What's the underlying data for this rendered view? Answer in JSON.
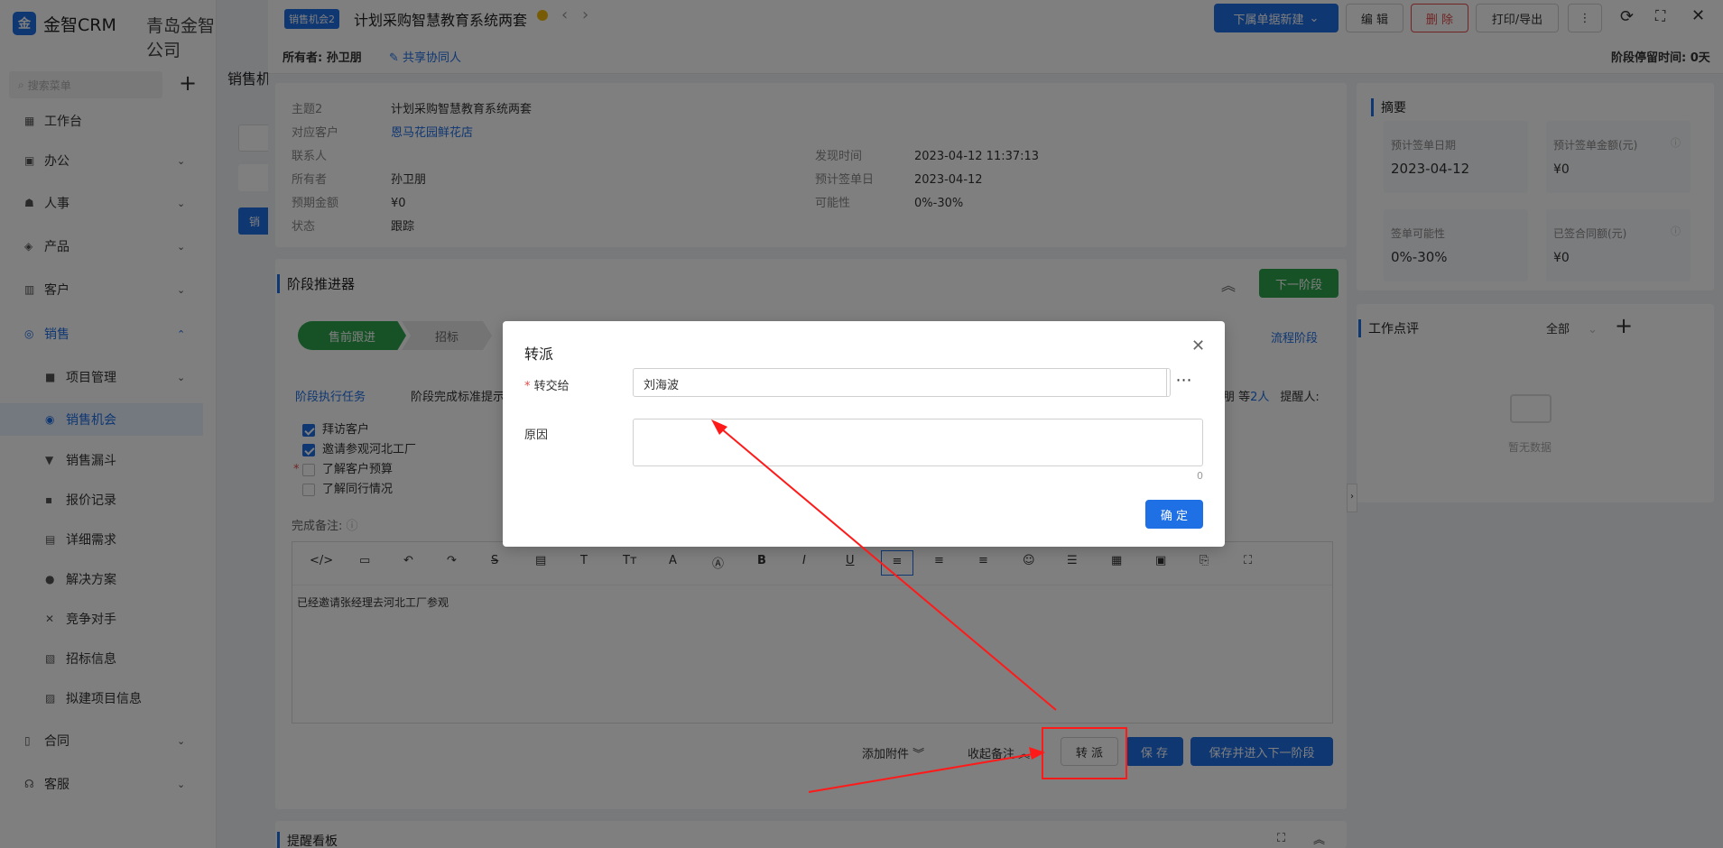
{
  "sidebar": {
    "logo_glyph": "金",
    "app_name": "金智CRM",
    "company": "青岛金智公司",
    "search_placeholder": "搜索菜单",
    "plus_glyph": "+",
    "items": [
      {
        "label": "工作台",
        "icon": "dashboard-icon",
        "glyph": "▦"
      },
      {
        "label": "办公",
        "icon": "office-icon",
        "glyph": "▣"
      },
      {
        "label": "人事",
        "icon": "people-icon",
        "glyph": "☗"
      },
      {
        "label": "产品",
        "icon": "product-icon",
        "glyph": "◈"
      },
      {
        "label": "客户",
        "icon": "customer-icon",
        "glyph": "▥"
      },
      {
        "label": "销售",
        "icon": "sales-icon",
        "glyph": "◎"
      },
      {
        "label": "项目管理",
        "icon": "folder-icon",
        "glyph": "■"
      },
      {
        "label": "销售机会",
        "icon": "opportunity-icon",
        "glyph": "◉"
      },
      {
        "label": "销售漏斗",
        "icon": "funnel-icon",
        "glyph": "▼"
      },
      {
        "label": "报价记录",
        "icon": "quote-icon",
        "glyph": "▪"
      },
      {
        "label": "详细需求",
        "icon": "document-icon",
        "glyph": "▤"
      },
      {
        "label": "解决方案",
        "icon": "bulb-icon",
        "glyph": "●"
      },
      {
        "label": "竞争对手",
        "icon": "versus-icon",
        "glyph": "✕"
      },
      {
        "label": "招标信息",
        "icon": "bid-icon",
        "glyph": "▧"
      },
      {
        "label": "拟建项目信息",
        "icon": "project-info-icon",
        "glyph": "▨"
      },
      {
        "label": "合同",
        "icon": "contract-icon",
        "glyph": "▯"
      },
      {
        "label": "客服",
        "icon": "service-icon",
        "glyph": "☊"
      }
    ]
  },
  "header": {
    "tag": "销售机会2",
    "title": "计划采购智慧教育系统两套",
    "prev": "‹",
    "next": "›",
    "owner_label": "所有者:",
    "owner": "孙卫朋",
    "share": "共享协同人",
    "stay_time": "阶段停留时间: 0天",
    "buttons": {
      "new_sub": "下属单据新建",
      "edit": "编 辑",
      "delete": "删 除",
      "print": "打印/导出",
      "more": "⋮",
      "refresh": "⟳",
      "fullscreen": "⛶",
      "close": "✕"
    }
  },
  "bg_page": {
    "title": "销售机",
    "btn": "销"
  },
  "info": {
    "left": [
      {
        "label": "主题2",
        "value": "计划采购智慧教育系统两套"
      },
      {
        "label": "对应客户",
        "value": "恩马花园鲜花店"
      },
      {
        "label": "联系人",
        "value": ""
      },
      {
        "label": "所有者",
        "value": "孙卫朋"
      },
      {
        "label": "预期金额",
        "value": "¥0"
      },
      {
        "label": "状态",
        "value": "跟踪"
      }
    ],
    "right": [
      {
        "label": "发现时间",
        "value": "2023-04-12 11:37:13"
      },
      {
        "label": "预计签单日",
        "value": "2023-04-12"
      },
      {
        "label": "可能性",
        "value": "0%-30%"
      }
    ]
  },
  "stage": {
    "title": "阶段推进器",
    "next_stage": "下一阶段",
    "pills": [
      "售前跟进",
      "招标"
    ],
    "flow_link": "流程阶段",
    "task_link": "阶段执行任务",
    "criteria": "阶段完成标准提示",
    "right_text_a": "朋 等",
    "right_count": "2人",
    "right_text_b": "提醒人:",
    "tasks": [
      {
        "label": "拜访客户",
        "checked": true,
        "required": false
      },
      {
        "label": "邀请参观河北工厂",
        "checked": true,
        "required": false
      },
      {
        "label": "了解客户预算",
        "checked": false,
        "required": true
      },
      {
        "label": "了解同行情况",
        "checked": false,
        "required": false
      }
    ],
    "remark_label": "完成备注:",
    "editor_text": "已经邀请张经理去河北工厂参观",
    "toolbar": [
      "</>",
      "▭",
      "↶",
      "↷",
      "S̶",
      "▤",
      "T",
      "Tт",
      "A",
      "Ⓐ",
      "B",
      "I",
      "U",
      "≡",
      "≡",
      "≡",
      "☺",
      "☰",
      "▦",
      "▣",
      "⎘",
      "⛶"
    ],
    "add_attachment": "添加附件",
    "collapse_remark": "收起备注",
    "transfer": "转 派",
    "save": "保 存",
    "save_next": "保存并进入下一阶段",
    "reminder_board": "提醒看板"
  },
  "summary": {
    "title": "摘要",
    "cards": [
      {
        "label": "预计签单日期",
        "value": "2023-04-12"
      },
      {
        "label": "预计签单金额(元)",
        "value": "¥0"
      },
      {
        "label": "签单可能性",
        "value": "0%-30%"
      },
      {
        "label": "已签合同额(元)",
        "value": "¥0"
      }
    ],
    "review_title": "工作点评",
    "review_filter": "全部",
    "empty": "暂无数据"
  },
  "modal": {
    "title": "转派",
    "assignee_label": "转交给",
    "assignee_value": "刘海波",
    "reason_label": "原因",
    "counter": "0",
    "confirm": "确 定",
    "close": "✕",
    "dots": "⋯"
  },
  "annotation_color": "#ff1a1a"
}
